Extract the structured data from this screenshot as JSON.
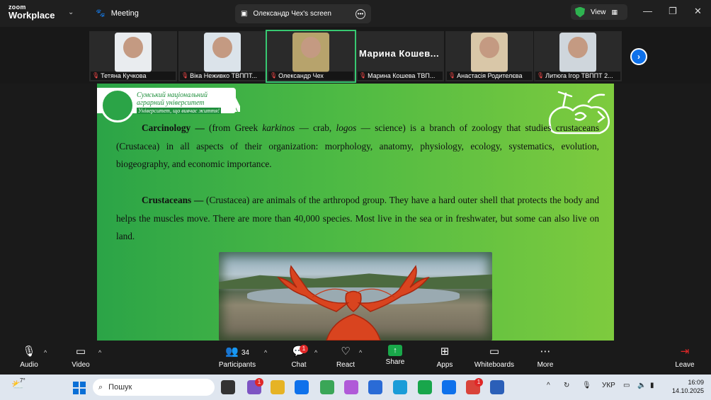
{
  "app": {
    "logo_line1": "zoom",
    "logo_line2": "Workplace",
    "meeting_label": "Meeting"
  },
  "screen_tab": {
    "title": "Олександр Чех's screen"
  },
  "view_button": {
    "label": "View"
  },
  "participants_strip": [
    {
      "name": "Тетяна Кучкова",
      "muted": true
    },
    {
      "name": "Віка Неживко ТВППТ...",
      "muted": true
    },
    {
      "name": "Олександр Чех",
      "muted": true,
      "active": true
    },
    {
      "name": "Марина Кошева ТВП...",
      "muted": true,
      "display_name": "Марина Кошев..."
    },
    {
      "name": "Анастасія Родителєва",
      "muted": true
    },
    {
      "name": "Литюга Ігор ТВППТ 2...",
      "muted": true
    }
  ],
  "slide": {
    "university_name_line1": "Сумський національний",
    "university_name_line2": "аграрний університет",
    "university_motto": "Університет, що вивчає життя!",
    "p1_term": "Carcinology —",
    "p1_a": " (from Greek ",
    "p1_karkinos": "karkinos",
    "p1_b": " — crab, ",
    "p1_logos": "logos",
    "p1_c": " — science) is a branch of zoology that studies crustaceans (Crustacea) in all aspects of their organization: morphology, anatomy, physiology, ecology, systematics, evolution, biogeography, and economic importance.",
    "p2_term": "Crustaceans —",
    "p2_text": " (Crustacea) are animals of the arthropod group. They have a hard outer shell that protects the body and helps the muscles move. There are more than 40,000 species. Most live in the sea or in freshwater, but some can also live on land."
  },
  "toolbar": {
    "audio": "Audio",
    "video": "Video",
    "participants": "Participants",
    "participants_count": "34",
    "chat": "Chat",
    "chat_badge": "1",
    "react": "React",
    "share": "Share",
    "apps": "Apps",
    "whiteboards": "Whiteboards",
    "more": "More",
    "leave": "Leave"
  },
  "taskbar": {
    "weather_temp": "7°",
    "search_placeholder": "Пошук",
    "language": "УКР",
    "time": "16:09",
    "date": "14.10.2025",
    "viber_badge": "1",
    "chrome_badge": "1"
  },
  "colors": {
    "slide_green": "#4cb944",
    "zoom_blue": "#0e71eb",
    "share_green": "#19a84a",
    "mute_red": "#e02828"
  }
}
